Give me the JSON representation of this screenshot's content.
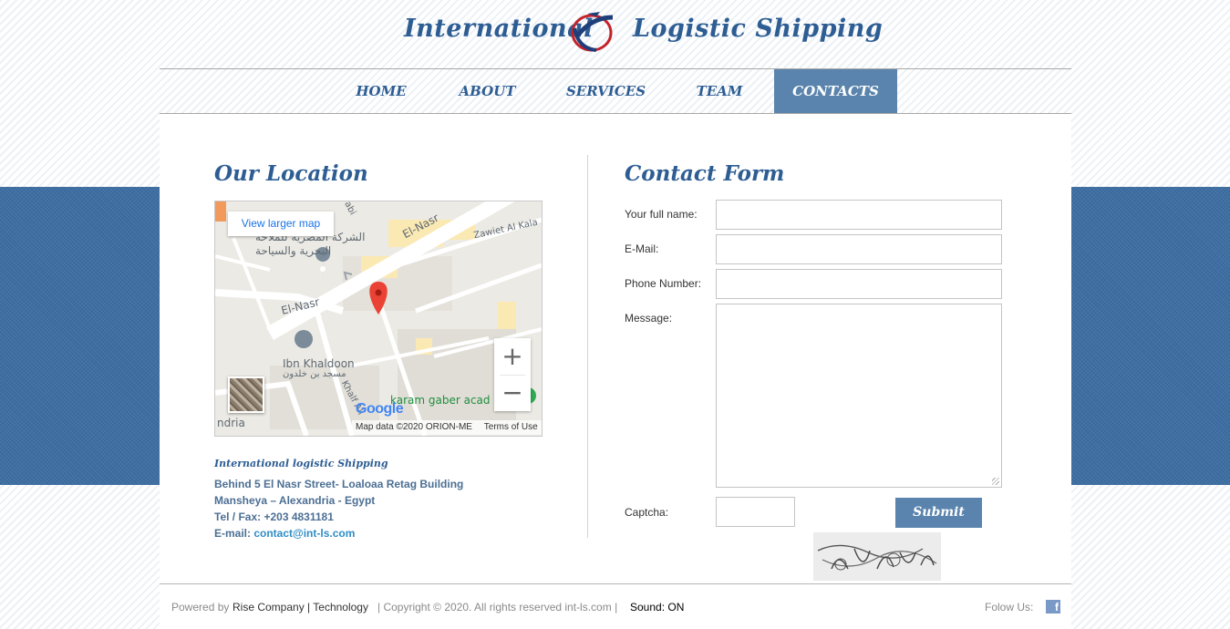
{
  "header": {
    "brand_left": "International",
    "brand_right": "Logistic Shipping"
  },
  "nav": {
    "items": [
      {
        "label": "HOME"
      },
      {
        "label": "ABOUT"
      },
      {
        "label": "SERVICES"
      },
      {
        "label": "TEAM"
      },
      {
        "label": "CONTACTS",
        "active": true
      }
    ]
  },
  "location": {
    "title": "Our Location",
    "map": {
      "view_larger": "View larger map",
      "labels": {
        "street1": "El-Nasr",
        "street2": "El-Nasr",
        "street3": "Zawiet Al Kala",
        "street4": "Khalf Ali",
        "poi_company_line1": "الشركة المصرية للملاحة",
        "poi_company_line2": "البحرية والسياحة",
        "mosque_en": "Ibn Khaldoon",
        "mosque_ar": "مسجد بن خلدون",
        "academy": "karam gaber acad",
        "city": "ndria",
        "abi": "abi"
      },
      "zoom_in": "+",
      "zoom_out": "−",
      "google": "Google",
      "map_data": "Map data ©2020 ORION-ME",
      "terms": "Terms of Use"
    },
    "company": "International logistic Shipping",
    "address_line1": "Behind 5 El Nasr Street- Loaloaa Retag Building",
    "address_line2": "Mansheya – Alexandria - Egypt",
    "tel": "Tel / Fax: +203 4831181",
    "email_label": "E-mail: ",
    "email": "contact@int-ls.com"
  },
  "contact_form": {
    "title": "Contact Form",
    "fields": {
      "full_name_label": "Your full name:",
      "email_label": "E-Mail:",
      "phone_label": "Phone Number:",
      "message_label": "Message:",
      "captcha_label": "Captcha:"
    },
    "submit": "Submit"
  },
  "footer": {
    "powered_by": "Powered by",
    "company": "Rise Company | Technology",
    "copyright": "| Copyright © 2020. All rights reserved int-ls.com  |",
    "sound": "Sound: ON",
    "follow": "Folow Us:",
    "facebook_icon": "facebook-icon"
  },
  "colors": {
    "brand_blue": "#2d5d93",
    "nav_active_bg": "#5a84ad",
    "band_blue": "#3d6ea3",
    "link": "#2f8ec6"
  }
}
